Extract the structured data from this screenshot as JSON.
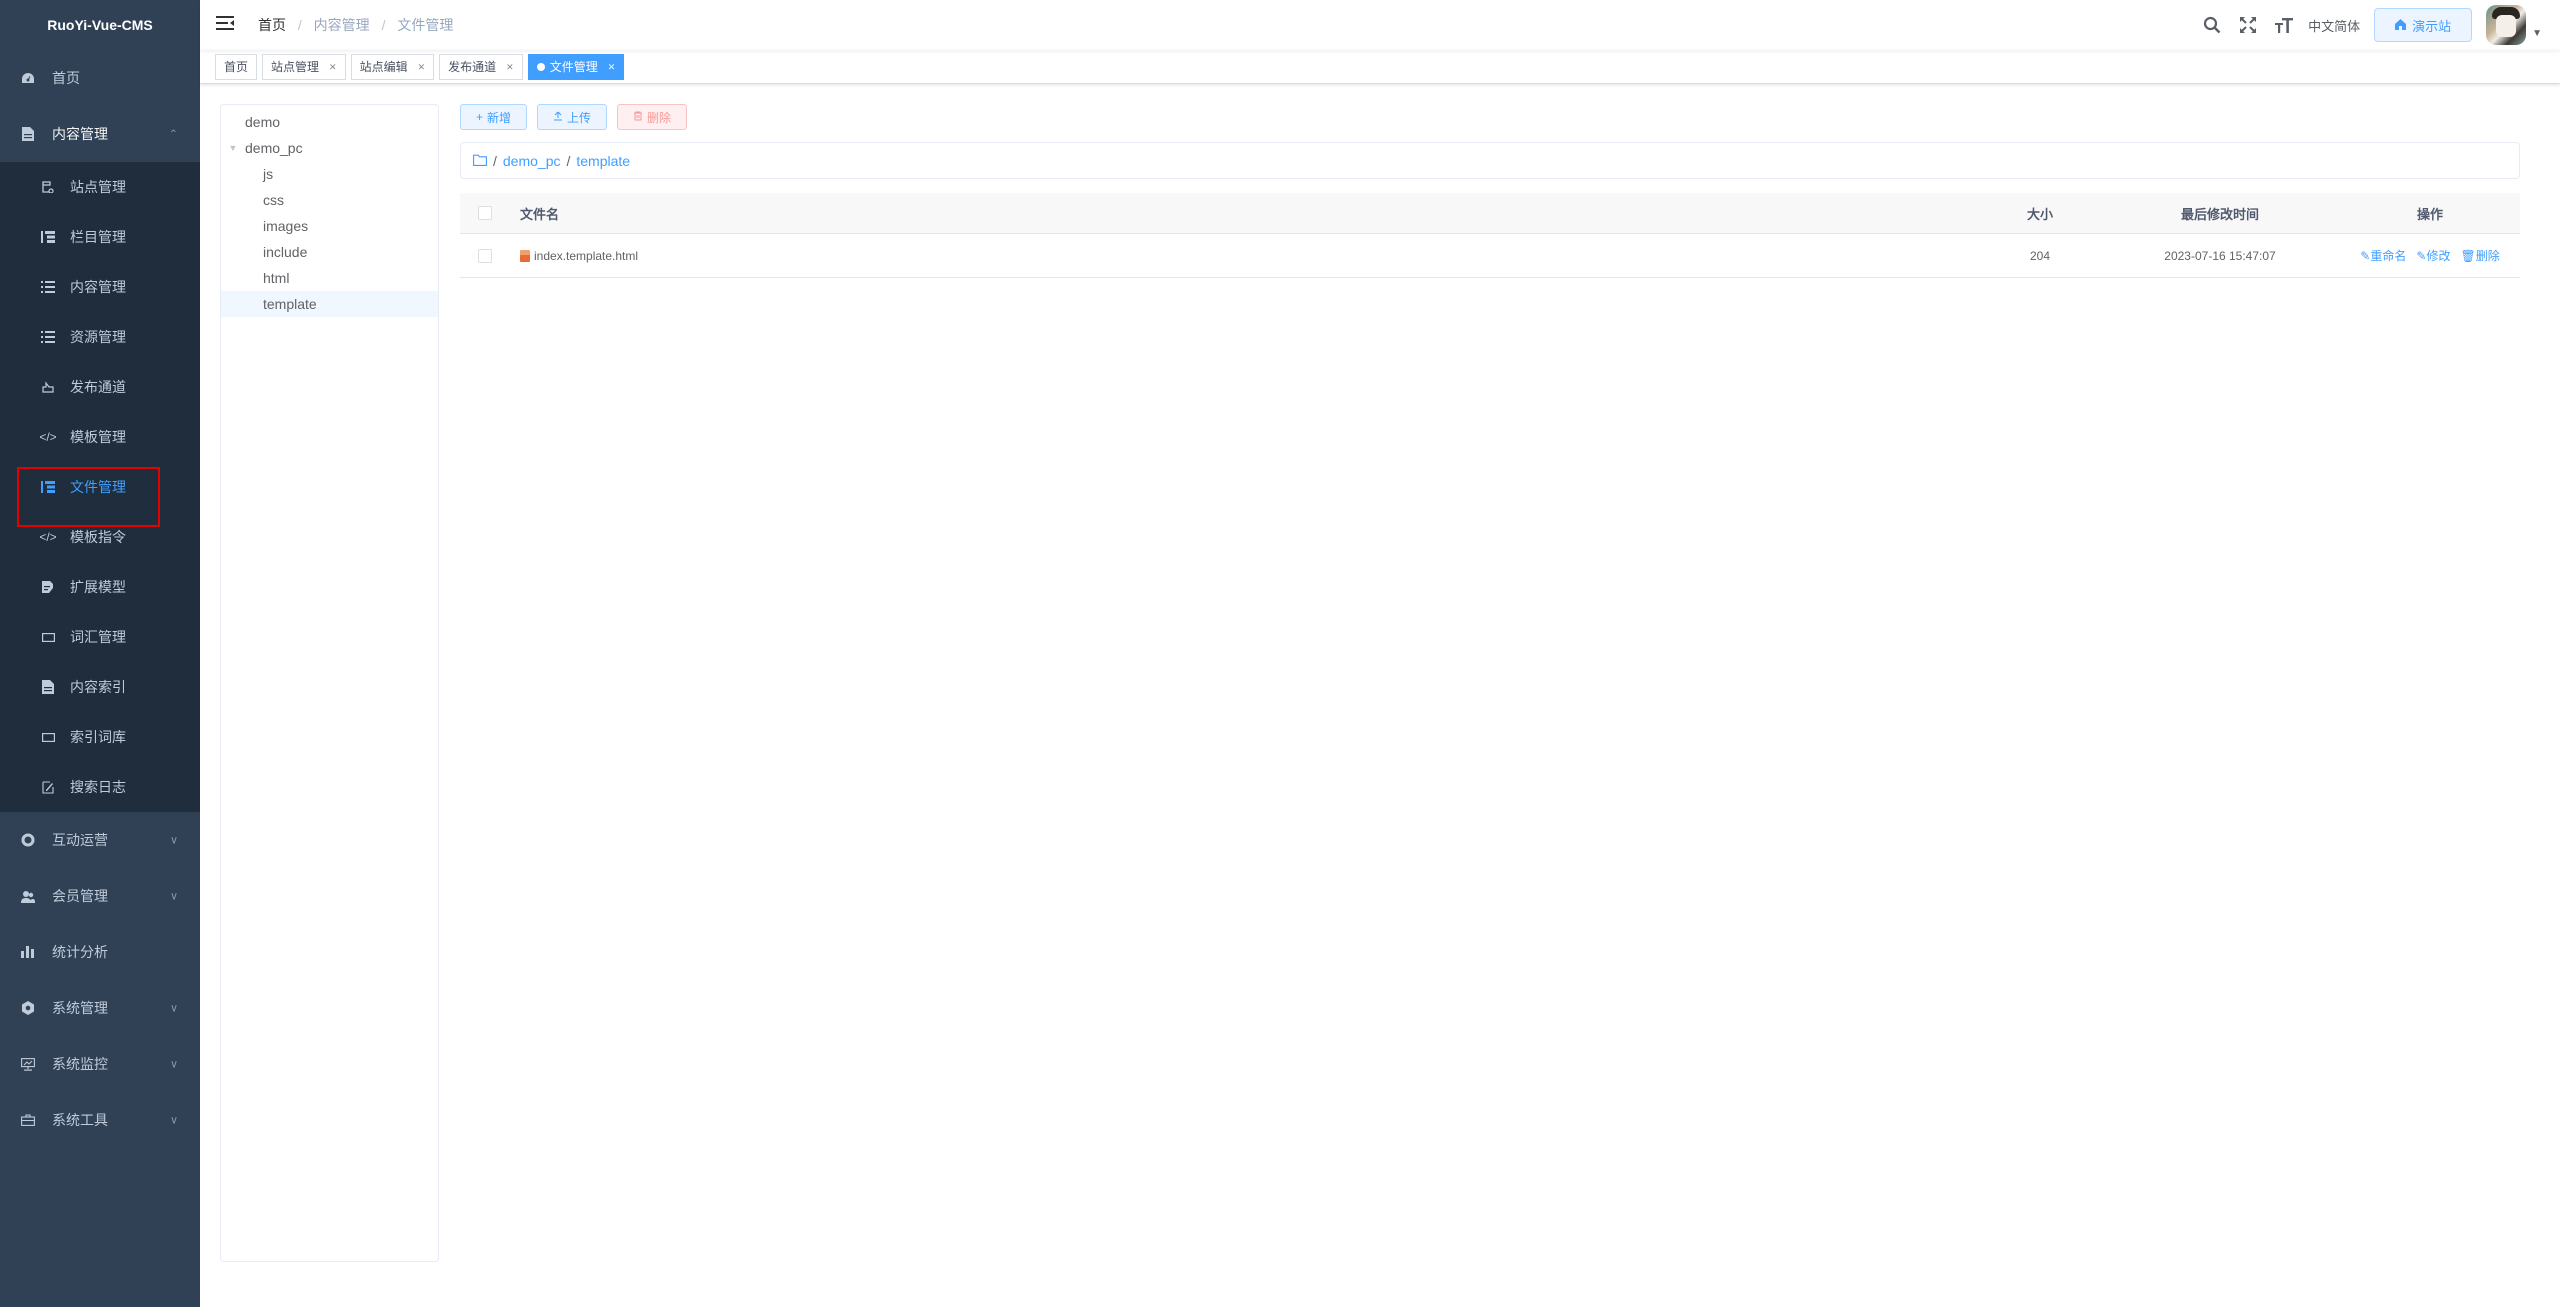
{
  "app": {
    "title": "RuoYi-Vue-CMS"
  },
  "sidebar": {
    "top_items": [
      {
        "label": "首页",
        "icon": "dashboard-icon"
      },
      {
        "label": "内容管理",
        "icon": "document-icon",
        "expanded": true
      }
    ],
    "content_submenu": [
      {
        "label": "站点管理",
        "icon": "site-icon"
      },
      {
        "label": "栏目管理",
        "icon": "tree-table-icon"
      },
      {
        "label": "内容管理",
        "icon": "list-icon"
      },
      {
        "label": "资源管理",
        "icon": "list-icon"
      },
      {
        "label": "发布通道",
        "icon": "publish-icon"
      },
      {
        "label": "模板管理",
        "icon": "code-icon"
      },
      {
        "label": "文件管理",
        "icon": "tree-table-icon",
        "active": true
      },
      {
        "label": "模板指令",
        "icon": "code-icon"
      },
      {
        "label": "扩展模型",
        "icon": "form-icon"
      },
      {
        "label": "词汇管理",
        "icon": "input-icon"
      },
      {
        "label": "内容索引",
        "icon": "document-icon"
      },
      {
        "label": "索引词库",
        "icon": "input-icon"
      },
      {
        "label": "搜索日志",
        "icon": "edit-icon"
      }
    ],
    "bottom_items": [
      {
        "label": "互动运营",
        "icon": "lifebuoy-icon",
        "has_children": true
      },
      {
        "label": "会员管理",
        "icon": "peoples-icon",
        "has_children": true
      },
      {
        "label": "统计分析",
        "icon": "chart-icon",
        "has_children": false
      },
      {
        "label": "系统管理",
        "icon": "gear-icon",
        "has_children": true
      },
      {
        "label": "系统监控",
        "icon": "monitor-icon",
        "has_children": true
      },
      {
        "label": "系统工具",
        "icon": "toolbox-icon",
        "has_children": true
      }
    ]
  },
  "header": {
    "breadcrumb": [
      "首页",
      "内容管理",
      "文件管理"
    ],
    "language": "中文简体",
    "demo_site_label": "演示站"
  },
  "tags": [
    {
      "label": "首页",
      "closable": false,
      "active": false
    },
    {
      "label": "站点管理",
      "closable": true,
      "active": false
    },
    {
      "label": "站点编辑",
      "closable": true,
      "active": false
    },
    {
      "label": "发布通道",
      "closable": true,
      "active": false
    },
    {
      "label": "文件管理",
      "closable": true,
      "active": true
    }
  ],
  "tree": {
    "nodes": [
      {
        "label": "demo",
        "level": 1,
        "expandable": false
      },
      {
        "label": "demo_pc",
        "level": 1,
        "expandable": true,
        "expanded": true
      },
      {
        "label": "js",
        "level": 2
      },
      {
        "label": "css",
        "level": 2
      },
      {
        "label": "images",
        "level": 2
      },
      {
        "label": "include",
        "level": 2
      },
      {
        "label": "html",
        "level": 2
      },
      {
        "label": "template",
        "level": 2,
        "selected": true
      }
    ]
  },
  "toolbar": {
    "add_label": "新增",
    "upload_label": "上传",
    "delete_label": "删除"
  },
  "path": {
    "separator": "/",
    "segments": [
      "demo_pc",
      "template"
    ]
  },
  "table": {
    "columns": {
      "name": "文件名",
      "size": "大小",
      "modified": "最后修改时间",
      "actions": "操作"
    },
    "rows": [
      {
        "name": "index.template.html",
        "size": "204",
        "modified": "2023-07-16 15:47:07"
      }
    ],
    "row_actions": {
      "rename": "重命名",
      "edit": "修改",
      "delete": "删除"
    }
  },
  "colors": {
    "sidebar_bg": "#304156",
    "submenu_bg": "#1f2d3d",
    "accent": "#409eff",
    "danger": "#f56c6c",
    "highlight_box": "#e60000"
  }
}
